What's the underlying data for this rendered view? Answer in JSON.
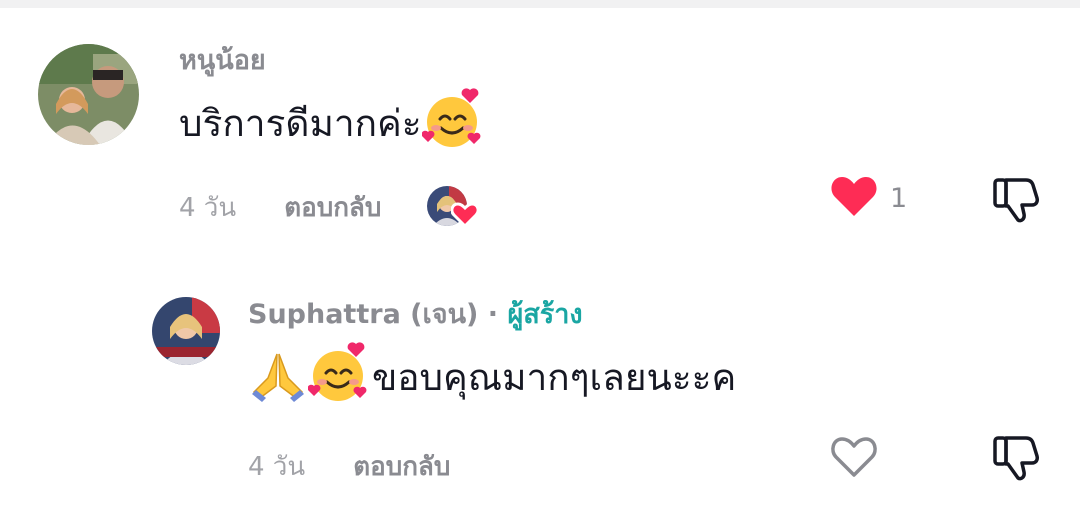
{
  "comments": [
    {
      "username": "หนูน้อย",
      "text": "บริการดีมากค่ะ",
      "emoji_after": "smiling-face-with-hearts",
      "time": "4 วัน",
      "reply_label": "ตอบกลับ",
      "creator_liked": true,
      "liked": true,
      "like_count": "1"
    },
    {
      "username": "Suphattra (เจน)",
      "separator": "·",
      "creator_tag": "ผู้สร้าง",
      "emoji_before": [
        "folded-hands",
        "smiling-face-with-hearts"
      ],
      "text": "ขอบคุณมากๆเลยนะะค",
      "time": "4 วัน",
      "reply_label": "ตอบกลับ",
      "liked": false,
      "like_count": ""
    }
  ],
  "colors": {
    "like_red": "#fe2c55",
    "username_gray": "#8a8b91",
    "creator_teal": "#1aa6a3",
    "text_dark": "#161823"
  }
}
